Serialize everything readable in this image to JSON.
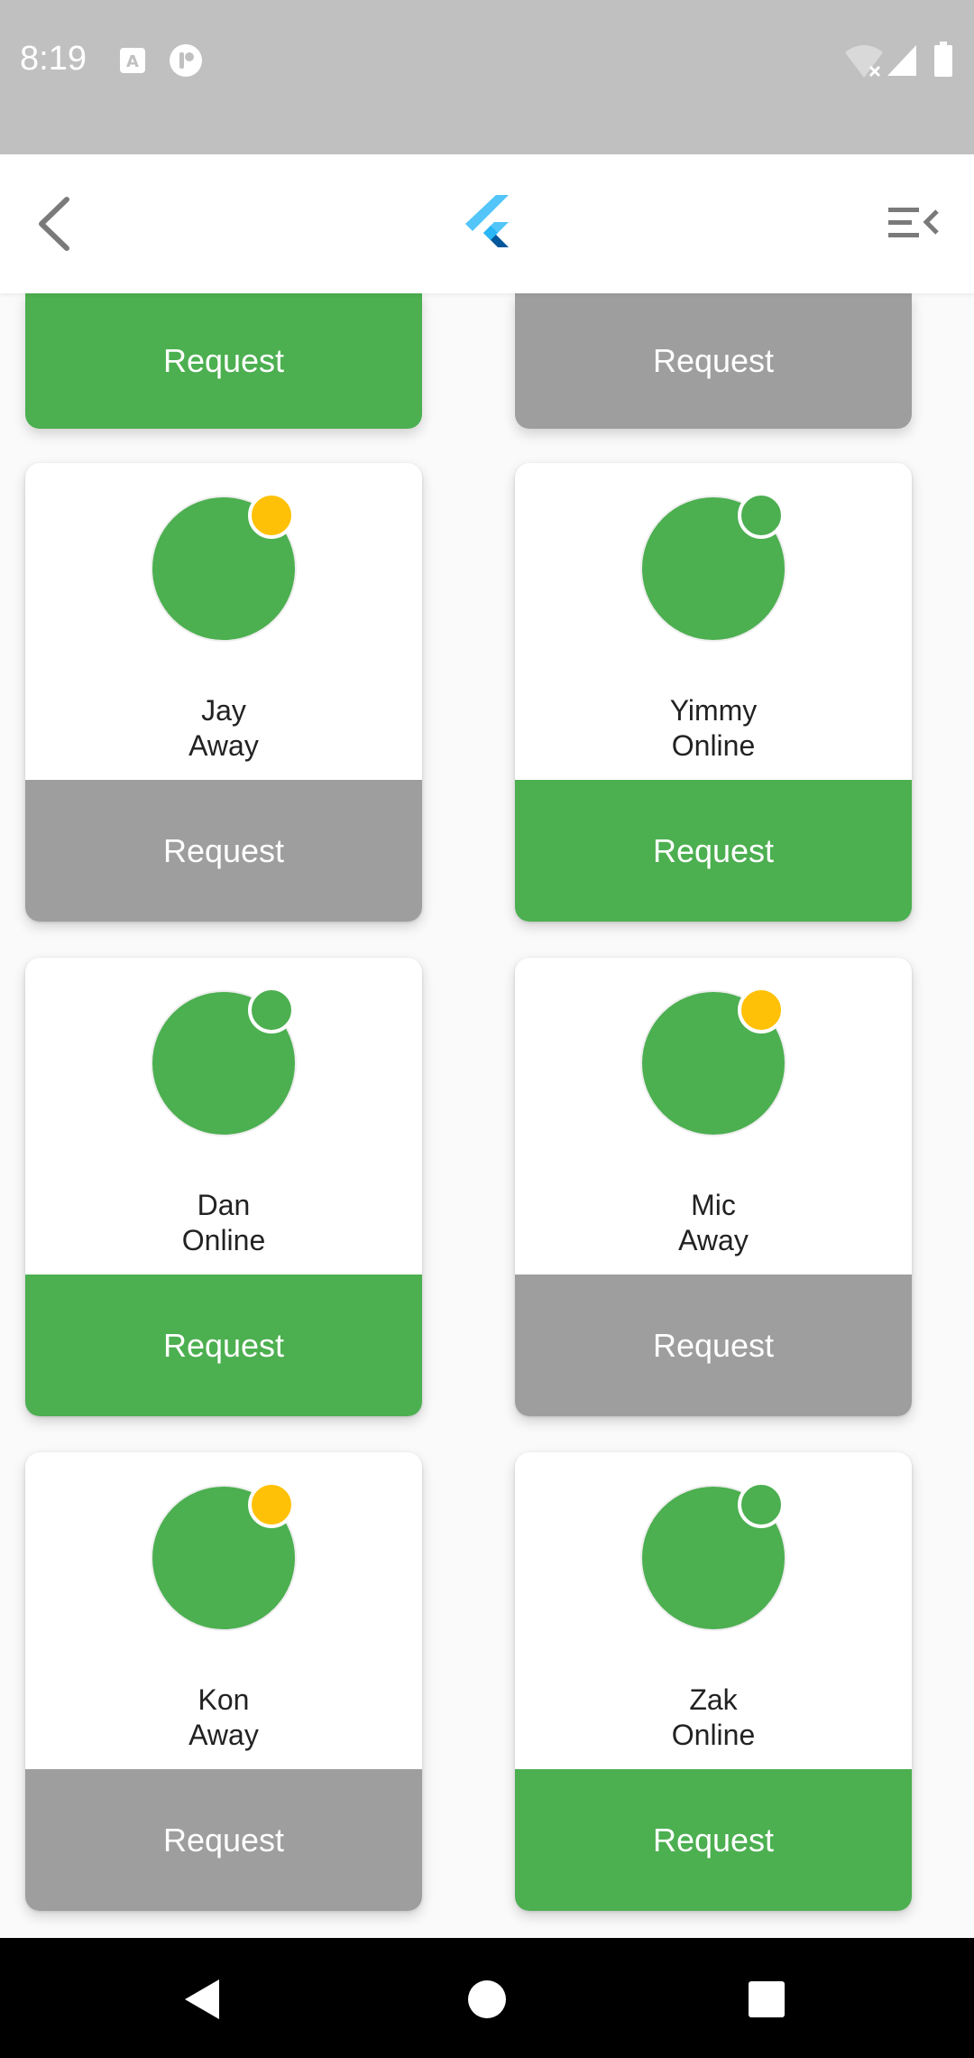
{
  "status_bar": {
    "time": "8:19",
    "icons": [
      "a-notification-icon",
      "app-notification-icon",
      "wifi-off-icon",
      "signal-icon",
      "battery-icon"
    ]
  },
  "app_bar": {
    "back_icon": "chevron-left-icon",
    "logo": "flutter-logo",
    "menu_icon": "menu-collapse-icon"
  },
  "colors": {
    "online": "#4caf50",
    "away": "#ffc107",
    "request_active": "#4caf50",
    "request_inactive": "#9e9e9e",
    "avatar": "#4caf50"
  },
  "partial_row": [
    {
      "label": "Request",
      "status": "online"
    },
    {
      "label": "Request",
      "status": "away"
    }
  ],
  "contacts": [
    {
      "name": "Jay",
      "status_label": "Away",
      "status": "away",
      "request_label": "Request"
    },
    {
      "name": "Yimmy",
      "status_label": "Online",
      "status": "online",
      "request_label": "Request"
    },
    {
      "name": "Dan",
      "status_label": "Online",
      "status": "online",
      "request_label": "Request"
    },
    {
      "name": "Mic",
      "status_label": "Away",
      "status": "away",
      "request_label": "Request"
    },
    {
      "name": "Kon",
      "status_label": "Away",
      "status": "away",
      "request_label": "Request"
    },
    {
      "name": "Zak",
      "status_label": "Online",
      "status": "online",
      "request_label": "Request"
    }
  ],
  "nav_bar": {
    "buttons": [
      "back-nav-icon",
      "home-nav-icon",
      "recents-nav-icon"
    ]
  }
}
